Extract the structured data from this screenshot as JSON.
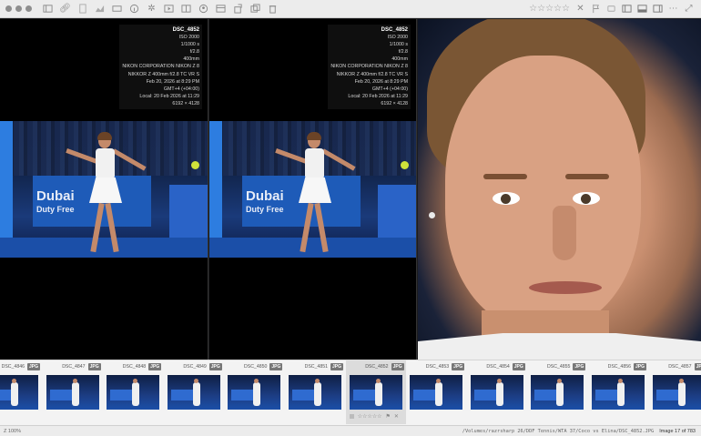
{
  "toolbar": {
    "icons": [
      "sidebar-icon",
      "link-icon",
      "document-icon",
      "chart-icon",
      "gallery-icon",
      "info-icon",
      "sparkle-icon",
      "frame-icon",
      "compare-icon",
      "face-icon",
      "rotate-icon",
      "duplicate-icon",
      "trash-icon"
    ],
    "right_icons": [
      "rating-stars",
      "reject-icon",
      "flag-icon",
      "label-icon",
      "panel-left-icon",
      "panel-bottom-icon",
      "panel-right-icon",
      "more-icon",
      "expand-icon"
    ],
    "stars": "☆☆☆☆☆"
  },
  "exif": {
    "filename": "DSC_4852",
    "iso": "ISO 2000",
    "shutter": "1/1000 s",
    "aperture": "f/2.8",
    "focal": "400mm",
    "camera": "NIKON CORPORATION NIKON Z 8",
    "lens": "NIKKOR Z 400mm f/2.8 TC VR S",
    "date": "Feb 20, 2026 at 8:29 PM",
    "timezone": "GMT+4 (+04:00)",
    "local": "Local: 20 Feb 2026 at 11:29",
    "dimensions": "6192 × 4128"
  },
  "photo": {
    "brand": "Dubai",
    "brand_sub": "Duty Free"
  },
  "filmstrip": {
    "items": [
      {
        "name": "DSC_4846",
        "type": "JPG"
      },
      {
        "name": "DSC_4847",
        "type": "JPG"
      },
      {
        "name": "DSC_4848",
        "type": "JPG"
      },
      {
        "name": "DSC_4849",
        "type": "JPG"
      },
      {
        "name": "DSC_4850",
        "type": "JPG"
      },
      {
        "name": "DSC_4851",
        "type": "JPG"
      },
      {
        "name": "DSC_4852",
        "type": "JPG",
        "selected": true
      },
      {
        "name": "DSC_4853",
        "type": "JPG"
      },
      {
        "name": "DSC_4854",
        "type": "JPG"
      },
      {
        "name": "DSC_4855",
        "type": "JPG"
      },
      {
        "name": "DSC_4856",
        "type": "JPG"
      },
      {
        "name": "DSC_4857",
        "type": "JPG"
      }
    ],
    "selected_stars": "☆☆☆☆☆"
  },
  "status": {
    "zoom": "Z 100%",
    "path": "/Volumes/razrsharp 26/DDF Tennis/WTA 37/Coco vs Elina/DSC_4852.JPG",
    "count": "Image 17 of 783"
  },
  "colors": {
    "toolbar_bg": "#ececec",
    "accent_ball": "#cfe23a",
    "court_blue": "#1b4fa8"
  }
}
